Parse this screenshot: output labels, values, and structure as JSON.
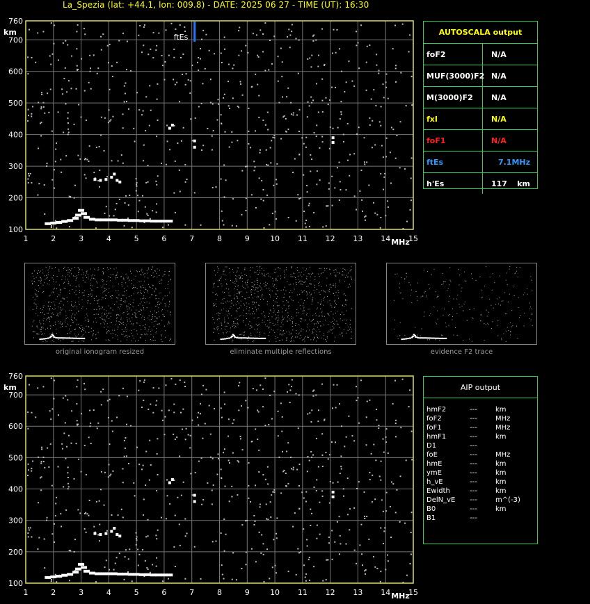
{
  "header": {
    "title": "La_Spezia (lat: +44.1, lon: 009.8) - DATE: 2025 06 27 - TIME (UT): 16:30"
  },
  "colors": {
    "fEs_marker": "#2277ff",
    "grid": "#777777",
    "axis": "#dddd66",
    "table_border": "#33cc55",
    "yellow": "#ffff00",
    "red": "#ff2222",
    "blue": "#3399ff"
  },
  "chart_data": [
    {
      "type": "scatter",
      "title": "",
      "xlabel": "MHz",
      "ylabel": "km",
      "xlim": [
        1,
        15
      ],
      "ylim": [
        100,
        760
      ],
      "xticks": [
        1,
        2,
        3,
        4,
        5,
        6,
        7,
        8,
        9,
        10,
        11,
        12,
        13,
        14,
        15
      ],
      "yticks": [
        100,
        200,
        300,
        400,
        500,
        600,
        700,
        760
      ],
      "grid": true,
      "marker": {
        "label": "ftEs",
        "freq": 7.1
      },
      "series": [
        {
          "values": [
            [
              1.8,
              118
            ],
            [
              2.0,
              120
            ],
            [
              2.2,
              122
            ],
            [
              2.4,
              125
            ],
            [
              2.6,
              128
            ],
            [
              2.8,
              135
            ],
            [
              2.9,
              145
            ],
            [
              3.0,
              160
            ],
            [
              3.1,
              150
            ],
            [
              3.2,
              138
            ],
            [
              3.4,
              132
            ],
            [
              3.6,
              130
            ],
            [
              3.8,
              130
            ],
            [
              4.0,
              130
            ],
            [
              4.2,
              130
            ],
            [
              4.4,
              129
            ],
            [
              4.6,
              129
            ],
            [
              4.8,
              128
            ],
            [
              5.0,
              128
            ],
            [
              5.2,
              127
            ],
            [
              5.4,
              127
            ],
            [
              5.6,
              126
            ],
            [
              5.8,
              126
            ],
            [
              6.0,
              126
            ],
            [
              6.2,
              126
            ]
          ]
        },
        {
          "values": [
            [
              3.5,
              258
            ],
            [
              3.7,
              255
            ],
            [
              3.9,
              258
            ],
            [
              4.1,
              265
            ],
            [
              4.2,
              275
            ],
            [
              4.3,
              255
            ],
            [
              4.4,
              250
            ]
          ]
        },
        {
          "values": [
            [
              6.2,
              420
            ],
            [
              6.3,
              430
            ],
            [
              7.1,
              380
            ],
            [
              7.1,
              360
            ],
            [
              12.1,
              390
            ],
            [
              12.1,
              375
            ]
          ]
        }
      ]
    },
    {
      "type": "scatter",
      "title": "",
      "xlabel": "MHz",
      "ylabel": "km",
      "xlim": [
        1,
        15
      ],
      "ylim": [
        100,
        760
      ],
      "xticks": [
        1,
        2,
        3,
        4,
        5,
        6,
        7,
        8,
        9,
        10,
        11,
        12,
        13,
        14,
        15
      ],
      "yticks": [
        100,
        200,
        300,
        400,
        500,
        600,
        700,
        760
      ],
      "grid": true,
      "series": [
        {
          "values": [
            [
              1.8,
              118
            ],
            [
              2.0,
              120
            ],
            [
              2.2,
              122
            ],
            [
              2.4,
              125
            ],
            [
              2.6,
              128
            ],
            [
              2.8,
              135
            ],
            [
              2.9,
              145
            ],
            [
              3.0,
              160
            ],
            [
              3.1,
              150
            ],
            [
              3.2,
              138
            ],
            [
              3.4,
              132
            ],
            [
              3.6,
              130
            ],
            [
              3.8,
              130
            ],
            [
              4.0,
              130
            ],
            [
              4.2,
              130
            ],
            [
              4.4,
              129
            ],
            [
              4.6,
              129
            ],
            [
              4.8,
              128
            ],
            [
              5.0,
              128
            ],
            [
              5.2,
              127
            ],
            [
              5.4,
              127
            ],
            [
              5.6,
              126
            ],
            [
              5.8,
              126
            ],
            [
              6.0,
              126
            ],
            [
              6.2,
              126
            ]
          ]
        },
        {
          "values": [
            [
              3.5,
              258
            ],
            [
              3.7,
              255
            ],
            [
              3.9,
              258
            ],
            [
              4.1,
              265
            ],
            [
              4.2,
              275
            ],
            [
              4.3,
              255
            ],
            [
              4.4,
              250
            ]
          ]
        },
        {
          "values": [
            [
              6.2,
              420
            ],
            [
              6.3,
              430
            ],
            [
              7.1,
              380
            ],
            [
              7.1,
              360
            ],
            [
              12.1,
              390
            ],
            [
              12.1,
              375
            ]
          ]
        }
      ]
    }
  ],
  "autoscala": {
    "heading": "AUTOSCALA output",
    "rows": [
      {
        "name": "foF2",
        "value": "N/A",
        "unit": "",
        "color": "#ffffff",
        "val_color": "#ffffff"
      },
      {
        "name": "MUF(3000)F2",
        "value": "N/A",
        "unit": "",
        "color": "#ffffff",
        "val_color": "#ffffff"
      },
      {
        "name": "M(3000)F2",
        "value": "N/A",
        "unit": "",
        "color": "#ffffff",
        "val_color": "#ffffff"
      },
      {
        "name": "fxI",
        "value": "N/A",
        "unit": "",
        "color": "#ffff00",
        "val_color": "#ffff00"
      },
      {
        "name": "foF1",
        "value": "N/A",
        "unit": "",
        "color": "#ff2222",
        "val_color": "#ff2222"
      },
      {
        "name": "ftEs",
        "value": "7.1",
        "unit": "MHz",
        "color": "#3399ff",
        "val_color": "#3399ff"
      },
      {
        "name": "h'Es",
        "value": "117",
        "unit": "km",
        "color": "#ffffff",
        "val_color": "#ffffff"
      }
    ]
  },
  "thumbnails": {
    "captions": [
      "original ionogram resized",
      "eliminate multiple reflections",
      "evidence F2 trace"
    ]
  },
  "aip": {
    "heading": "AIP output",
    "rows": [
      [
        "hmF2",
        "---",
        "km"
      ],
      [
        "foF2",
        "---",
        "MHz"
      ],
      [
        "foF1",
        "---",
        "MHz"
      ],
      [
        "hmF1",
        "---",
        "km"
      ],
      [
        "D1",
        "---",
        ""
      ],
      [
        "foE",
        "---",
        "MHz"
      ],
      [
        "hmE",
        "---",
        "km"
      ],
      [
        "ymE",
        "---",
        "km"
      ],
      [
        "h_vE",
        "---",
        "km"
      ],
      [
        "Ewidth",
        "---",
        "km"
      ],
      [
        "DelN_vE",
        "---",
        "m^(-3)"
      ],
      [
        "B0",
        "---",
        "km"
      ],
      [
        "B1",
        "---",
        ""
      ]
    ]
  }
}
